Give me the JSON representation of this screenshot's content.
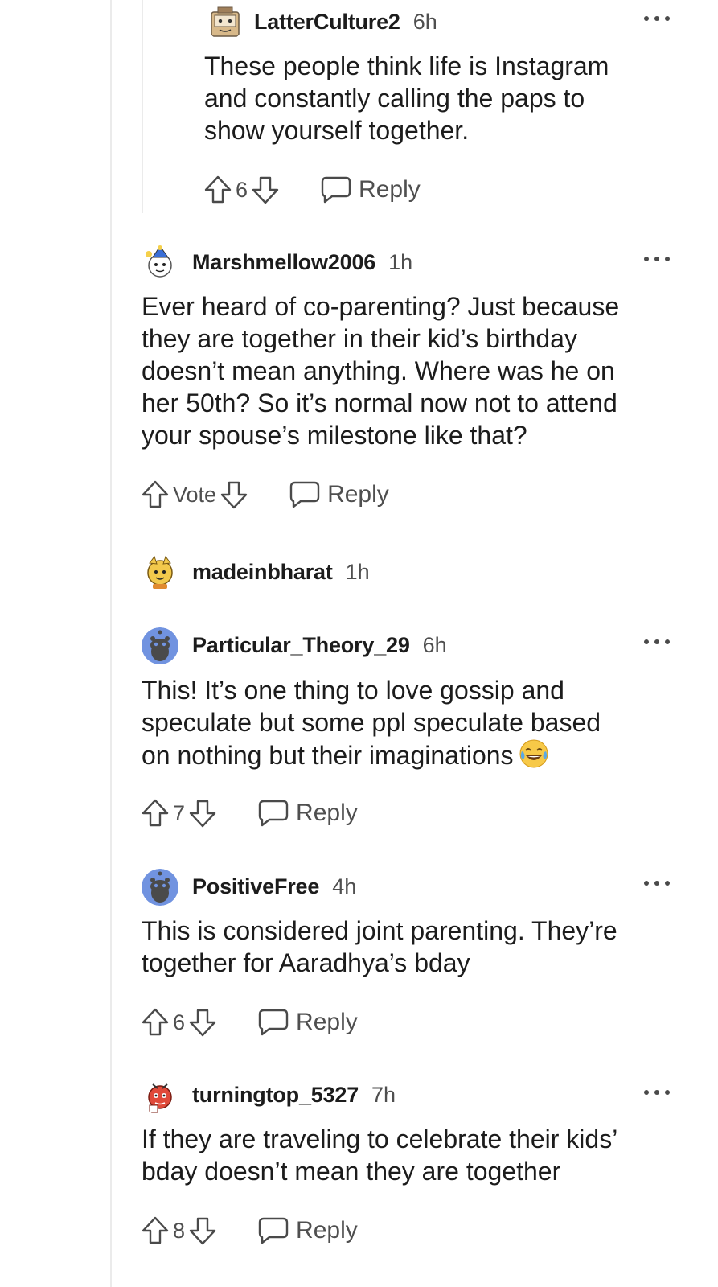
{
  "comments": [
    {
      "username": "LatterCulture2",
      "time": "6h",
      "text": "These people think life is Instagram\nand constantly calling the paps to\nshow yourself together.",
      "votes": "6",
      "reply": "Reply"
    },
    {
      "username": "Marshmellow2006",
      "time": "1h",
      "text": "Ever heard of co-parenting? Just because\nthey are together in their kid’s birthday\ndoesn’t mean anything. Where was he on\nher 50th? So it’s normal now not to attend\nyour spouse’s milestone like that?",
      "votes": "Vote",
      "reply": "Reply"
    },
    {
      "username": "madeinbharat",
      "time": "1h"
    },
    {
      "username": "Particular_Theory_29",
      "time": "6h",
      "text": "This! It’s one thing to love gossip and\nspeculate but some ppl speculate based\non nothing but their imaginations",
      "emoji": "tears-of-joy-emoji",
      "votes": "7",
      "reply": "Reply"
    },
    {
      "username": "PositiveFree",
      "time": "4h",
      "text": "This is considered joint parenting. They’re\ntogether for Aaradhya’s bday",
      "votes": "6",
      "reply": "Reply"
    },
    {
      "username": "turningtop_5327",
      "time": "7h",
      "text": "If they are traveling to celebrate their kids’\nbday doesn’t mean they are together",
      "votes": "8",
      "reply": "Reply"
    }
  ],
  "icons": {
    "upvote": "arrow-up-outline-icon",
    "downvote": "arrow-down-outline-icon",
    "reply": "speech-bubble-icon",
    "more": "ellipsis-icon"
  },
  "colors": {
    "text": "#1c1c1c",
    "muted": "#4f4f4f",
    "thread_line": "#ebebeb",
    "default_avatar": "#7193e0"
  }
}
